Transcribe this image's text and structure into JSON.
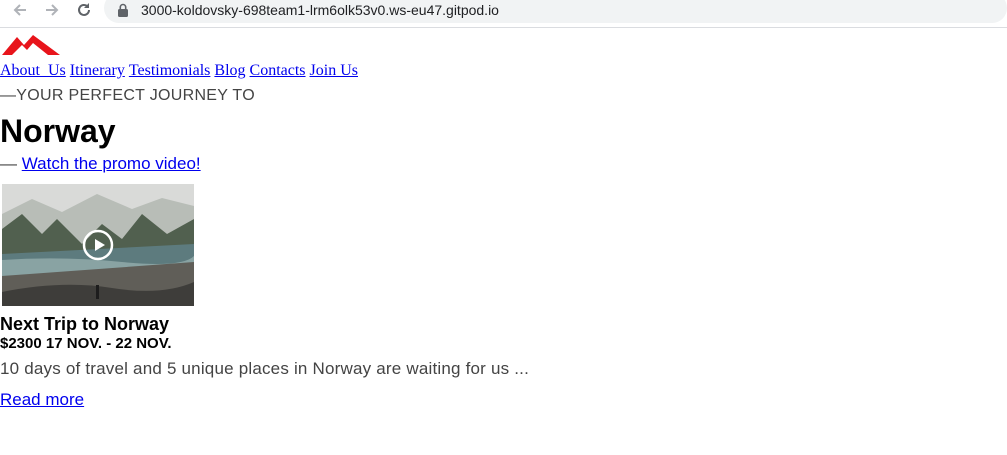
{
  "browser": {
    "url": "3000-koldovsky-698team1-lrm6olk53v0.ws-eu47.gitpod.io",
    "icons": [
      "back-arrow-icon",
      "forward-arrow-icon",
      "reload-icon",
      "lock-icon"
    ]
  },
  "header": {
    "logo_icon": "mountain-logo-icon",
    "logo_color": "#e8141b",
    "nav": [
      "About_Us",
      "Itinerary",
      "Testimonials",
      "Blog",
      "Contacts",
      "Join Us"
    ]
  },
  "hero": {
    "eyebrow": "—YOUR PERFECT JOURNEY TO",
    "title": "Norway",
    "promo_dash": "— ",
    "promo_link": "Watch the promo video!"
  },
  "trip_card": {
    "play_icon": "play-circle-icon",
    "title": "Next Trip to Norway",
    "meta": "$2300 17 NOV. - 22 NOV.",
    "description": "10 days of travel and 5 unique places in Norway are waiting for us ...",
    "read_more": "Read more"
  },
  "colors": {
    "link": "#0000ee",
    "muted_text": "#444444",
    "address_bar": "#f1f3f4"
  }
}
